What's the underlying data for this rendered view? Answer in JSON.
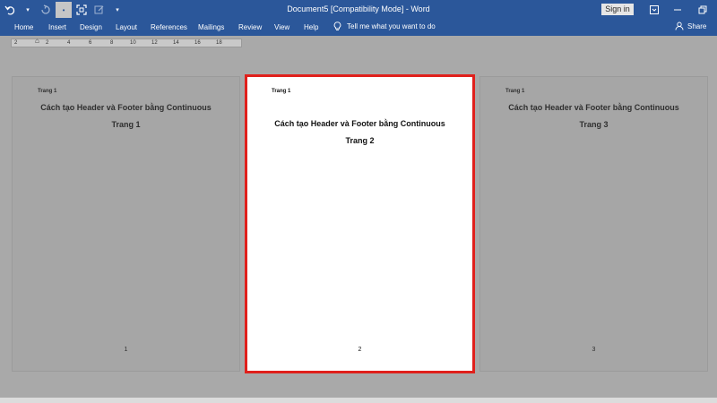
{
  "titlebar": {
    "title": "Document5 [Compatibility Mode] - Word",
    "sign_in": "Sign in"
  },
  "ribbon": {
    "tabs": [
      "Home",
      "Insert",
      "Design",
      "Layout",
      "References",
      "Mailings",
      "Review",
      "View",
      "Help"
    ],
    "tell_me": "Tell me what you want to do",
    "share": "Share"
  },
  "ruler": {
    "marks": [
      "2",
      "2",
      "4",
      "6",
      "8",
      "10",
      "12",
      "14",
      "16",
      "18"
    ]
  },
  "pages": [
    {
      "header": "Trang 1",
      "title": "Cách tạo Header và Footer bằng Continuous",
      "subtitle": "Trang 1",
      "number": "1"
    },
    {
      "header": "Trang 1",
      "title": "Cách tạo Header và Footer bằng Continuous",
      "subtitle": "Trang 2",
      "number": "2"
    },
    {
      "header": "Trang 1",
      "title": "Cách tạo Header và Footer bằng Continuous",
      "subtitle": "Trang 3",
      "number": "3"
    }
  ],
  "colors": {
    "titlebar": "#2b579a",
    "canvas": "#a9a9a9",
    "highlight": "#e0201c"
  }
}
